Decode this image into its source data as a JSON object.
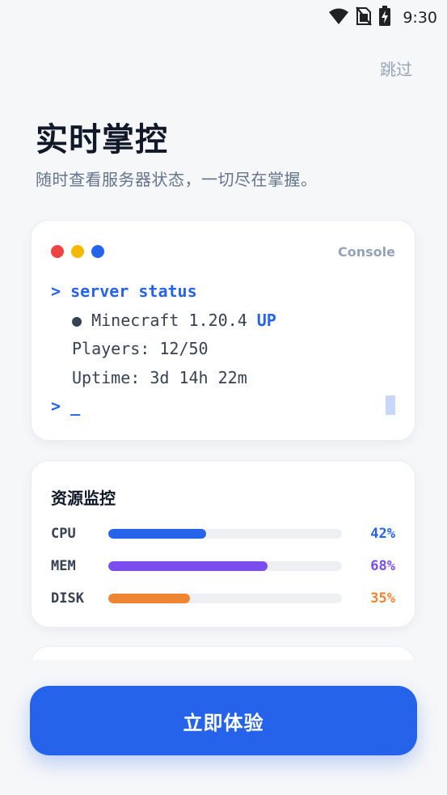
{
  "status_bar": {
    "time": "9:30",
    "icons": [
      "wifi-icon",
      "no-sim-icon",
      "battery-charging-icon"
    ]
  },
  "skip_label": "跳过",
  "title": "实时掌控",
  "subtitle": "随时查看服务器状态，一切尽在掌握。",
  "console": {
    "label": "Console",
    "window_dots": [
      "#ef4444",
      "#f5b800",
      "#2563eb"
    ],
    "prompt_symbol": ">",
    "command": "server status",
    "server_line": "● Minecraft 1.20.4",
    "server_state": "UP",
    "players_line": "Players: 12/50",
    "uptime_line": "Uptime: 3d 14h 22m",
    "input_cursor": "_"
  },
  "resources": {
    "title": "资源监控",
    "items": [
      {
        "label": "CPU",
        "value": "42%",
        "percent": 42,
        "color": "#2563eb"
      },
      {
        "label": "MEM",
        "value": "68%",
        "percent": 68,
        "color": "#7c4dee"
      },
      {
        "label": "DISK",
        "value": "35%",
        "percent": 35,
        "color": "#ee8533"
      }
    ]
  },
  "cta_label": "立即体验",
  "colors": {
    "accent": "#2563eb",
    "background": "#f6f7f9"
  }
}
